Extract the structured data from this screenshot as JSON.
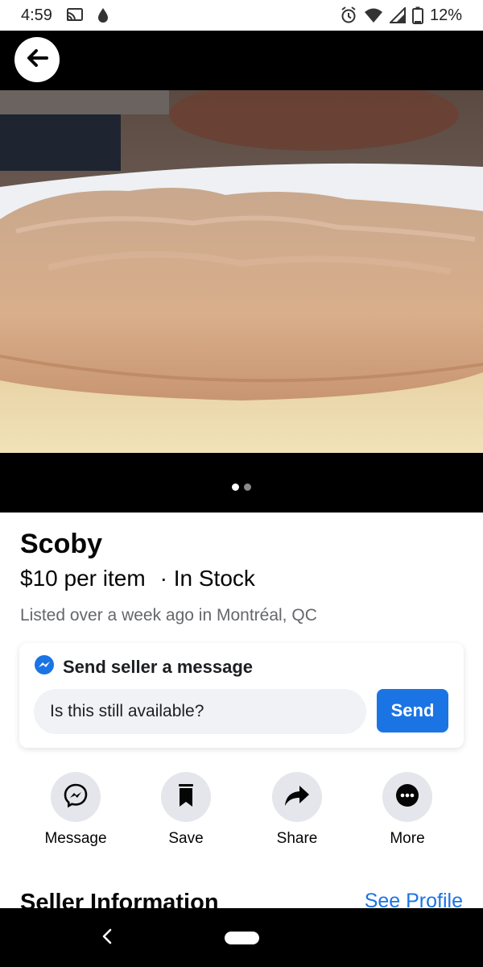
{
  "status_bar": {
    "time": "4:59",
    "battery": "12%",
    "icons": [
      "cast-icon",
      "drop-icon",
      "alarm-icon",
      "wifi-icon",
      "signal-icon",
      "battery-icon"
    ]
  },
  "listing": {
    "image_count": 2,
    "active_image": 1,
    "title": "Scoby",
    "price": "$10 per item",
    "stock": "· In Stock",
    "listed": "Listed over a week ago in Montréal, QC"
  },
  "message_card": {
    "heading": "Send seller a message",
    "input_value": "Is this still available?",
    "send_label": "Send"
  },
  "actions": [
    {
      "label": "Message",
      "icon": "messenger-icon"
    },
    {
      "label": "Save",
      "icon": "bookmark-icon"
    },
    {
      "label": "Share",
      "icon": "share-arrow-icon"
    },
    {
      "label": "More",
      "icon": "more-dots-icon"
    }
  ],
  "seller_info": {
    "title": "Seller Information",
    "see_profile": "See Profile"
  },
  "colors": {
    "accent": "#1b74e4",
    "button_bg": "#e4e6eb",
    "secondary_text": "#65676b"
  }
}
